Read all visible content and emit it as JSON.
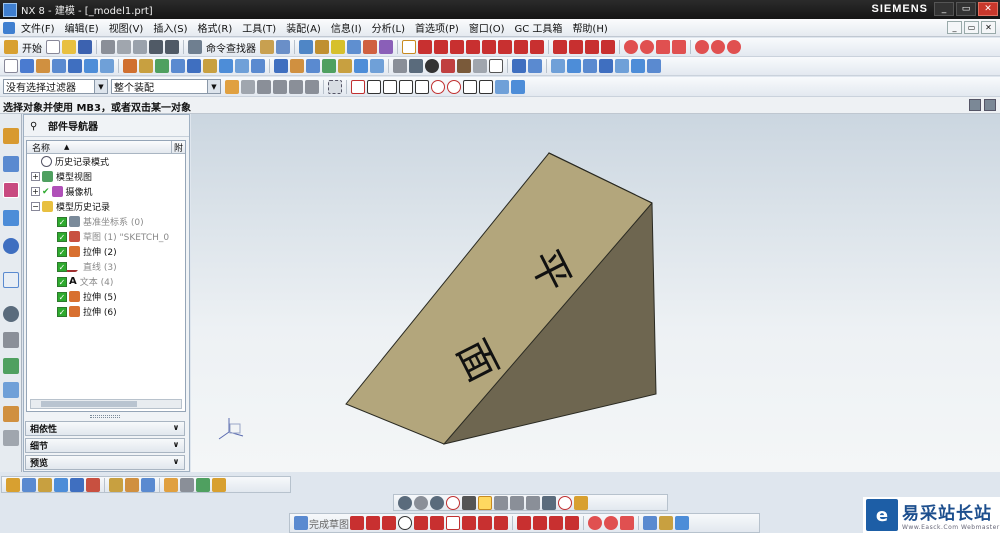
{
  "window": {
    "title": "NX 8 - 建模 - [_model1.prt]",
    "brand": "SIEMENS",
    "controls": [
      "_",
      "▭",
      "✕"
    ],
    "doc_controls": [
      "_",
      "▭",
      "✕"
    ]
  },
  "menubar": {
    "items": [
      "文件(F)",
      "编辑(E)",
      "视图(V)",
      "插入(S)",
      "格式(R)",
      "工具(T)",
      "装配(A)",
      "信息(I)",
      "分析(L)",
      "首选项(P)",
      "窗口(O)",
      "GC 工具箱",
      "帮助(H)"
    ]
  },
  "toolbar1": {
    "start_label": "开始",
    "command_finder_label": "命令查找器"
  },
  "selectionbar": {
    "filter_value": "没有选择过滤器",
    "scope_value": "整个装配"
  },
  "status": {
    "prompt": "选择对象并使用 MB3，或者双击某一对象"
  },
  "navigator": {
    "title": "部件导航器",
    "column_name": "名称",
    "column_sort": "▲",
    "column_extra": "附",
    "rows": [
      {
        "label": "历史记录模式"
      },
      {
        "label": "模型视图"
      },
      {
        "label": "摄像机"
      },
      {
        "label": "模型历史记录"
      },
      {
        "label": "基准坐标系 (0)"
      },
      {
        "label": "草图 (1) \"SKETCH_0"
      },
      {
        "label": "拉伸 (2)"
      },
      {
        "label": "直线 (3)"
      },
      {
        "label": "文本 (4)"
      },
      {
        "label": "拉伸 (5)"
      },
      {
        "label": "拉伸 (6)"
      }
    ],
    "sections": [
      "相依性",
      "细节",
      "预览"
    ]
  },
  "model": {
    "engraved_text": [
      "平",
      "面"
    ],
    "top_face_color": "#b3a67c",
    "side_face_color": "#6e6650",
    "edge_color": "#2a2a22"
  },
  "bottom_toolbar": {
    "finish_sketch_label": "完成草图"
  },
  "watermark": {
    "logo_glyph": "e",
    "text": "易采站长站",
    "subtext": "Www.Easck.Com Webmaster"
  },
  "colors": {
    "title_bg": "#1c1c1c",
    "accent_green": "#2eaa2e",
    "watermark_blue": "#1d5ea6"
  }
}
